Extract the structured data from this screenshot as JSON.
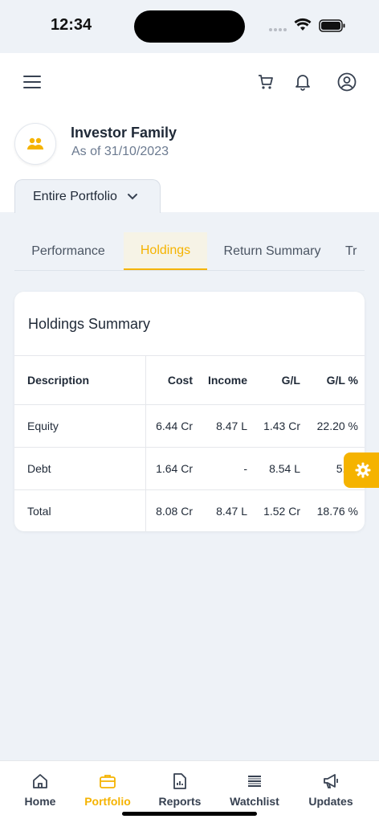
{
  "status": {
    "time": "12:34"
  },
  "colors": {
    "accent": "#f5b300",
    "background": "#eef2f7"
  },
  "header": {
    "icons": [
      "menu-icon",
      "cart-icon",
      "bell-icon",
      "user-circle-icon"
    ],
    "investor_name": "Investor Family",
    "as_of": "As of 31/10/2023",
    "portfolio_select": "Entire Portfolio"
  },
  "tabs": [
    {
      "label": "Performance",
      "active": false
    },
    {
      "label": "Holdings",
      "active": true
    },
    {
      "label": "Return Summary",
      "active": false
    },
    {
      "label": "Tr",
      "active": false
    }
  ],
  "holdings": {
    "title": "Holdings Summary",
    "columns": [
      "Description",
      "Cost",
      "Income",
      "G/L",
      "G/L %"
    ],
    "rows": [
      [
        "Equity",
        "6.44 Cr",
        "8.47 L",
        "1.43 Cr",
        "22.20 %"
      ],
      [
        "Debt",
        "1.64 Cr",
        "-",
        "8.54 L",
        "5.22"
      ],
      [
        "Total",
        "8.08 Cr",
        "8.47 L",
        "1.52 Cr",
        "18.76 %"
      ]
    ]
  },
  "bottom_nav": [
    {
      "label": "Home",
      "icon": "home-icon",
      "active": false
    },
    {
      "label": "Portfolio",
      "icon": "briefcase-icon",
      "active": true
    },
    {
      "label": "Reports",
      "icon": "report-icon",
      "active": false
    },
    {
      "label": "Watchlist",
      "icon": "list-icon",
      "active": false
    },
    {
      "label": "Updates",
      "icon": "megaphone-icon",
      "active": false
    }
  ]
}
